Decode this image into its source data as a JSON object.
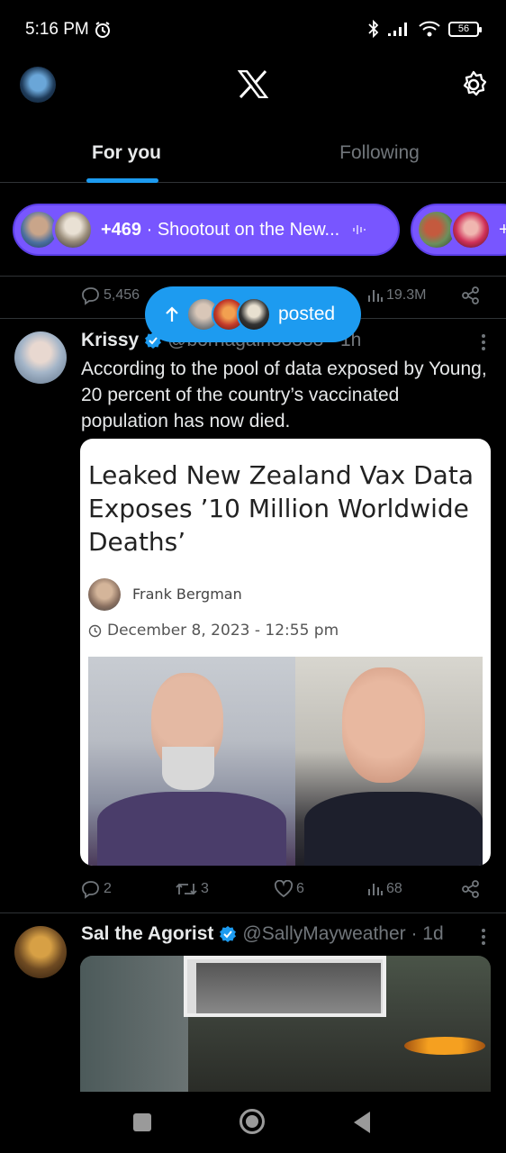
{
  "status_bar": {
    "time": "5:16 PM",
    "battery": "56"
  },
  "header": {
    "logo_icon": "x-logo-icon",
    "settings_icon": "gear-icon"
  },
  "tabs": [
    {
      "label": "For you",
      "selected": true
    },
    {
      "label": "Following",
      "selected": false
    }
  ],
  "spaces": {
    "count": "+469",
    "title": "· Shootout on the New...",
    "next_count": "+"
  },
  "previous_tweet": {
    "replies": "5,456",
    "views": "19.3M"
  },
  "posted_pill": {
    "label": "posted"
  },
  "tweet1": {
    "name": "Krissy",
    "handle": "@bornagain33333 · 1h",
    "text": "According to the pool of data exposed by Young, 20 percent of the country’s vaccinated population has now died.",
    "card": {
      "title": "Leaked New Zealand Vax Data Exposes ’10 Million Worldwide Deaths’",
      "author": "Frank Bergman",
      "date": "December 8, 2023 - 12:55 pm"
    },
    "replies": "2",
    "reposts": "3",
    "likes": "6",
    "views": "68"
  },
  "tweet2": {
    "name": "Sal the Agorist",
    "handle": "@SallyMayweather · 1d"
  },
  "colors": {
    "accent": "#1d9bf0",
    "spaces": "#7856ff",
    "background": "#000000",
    "muted": "#71767b"
  }
}
